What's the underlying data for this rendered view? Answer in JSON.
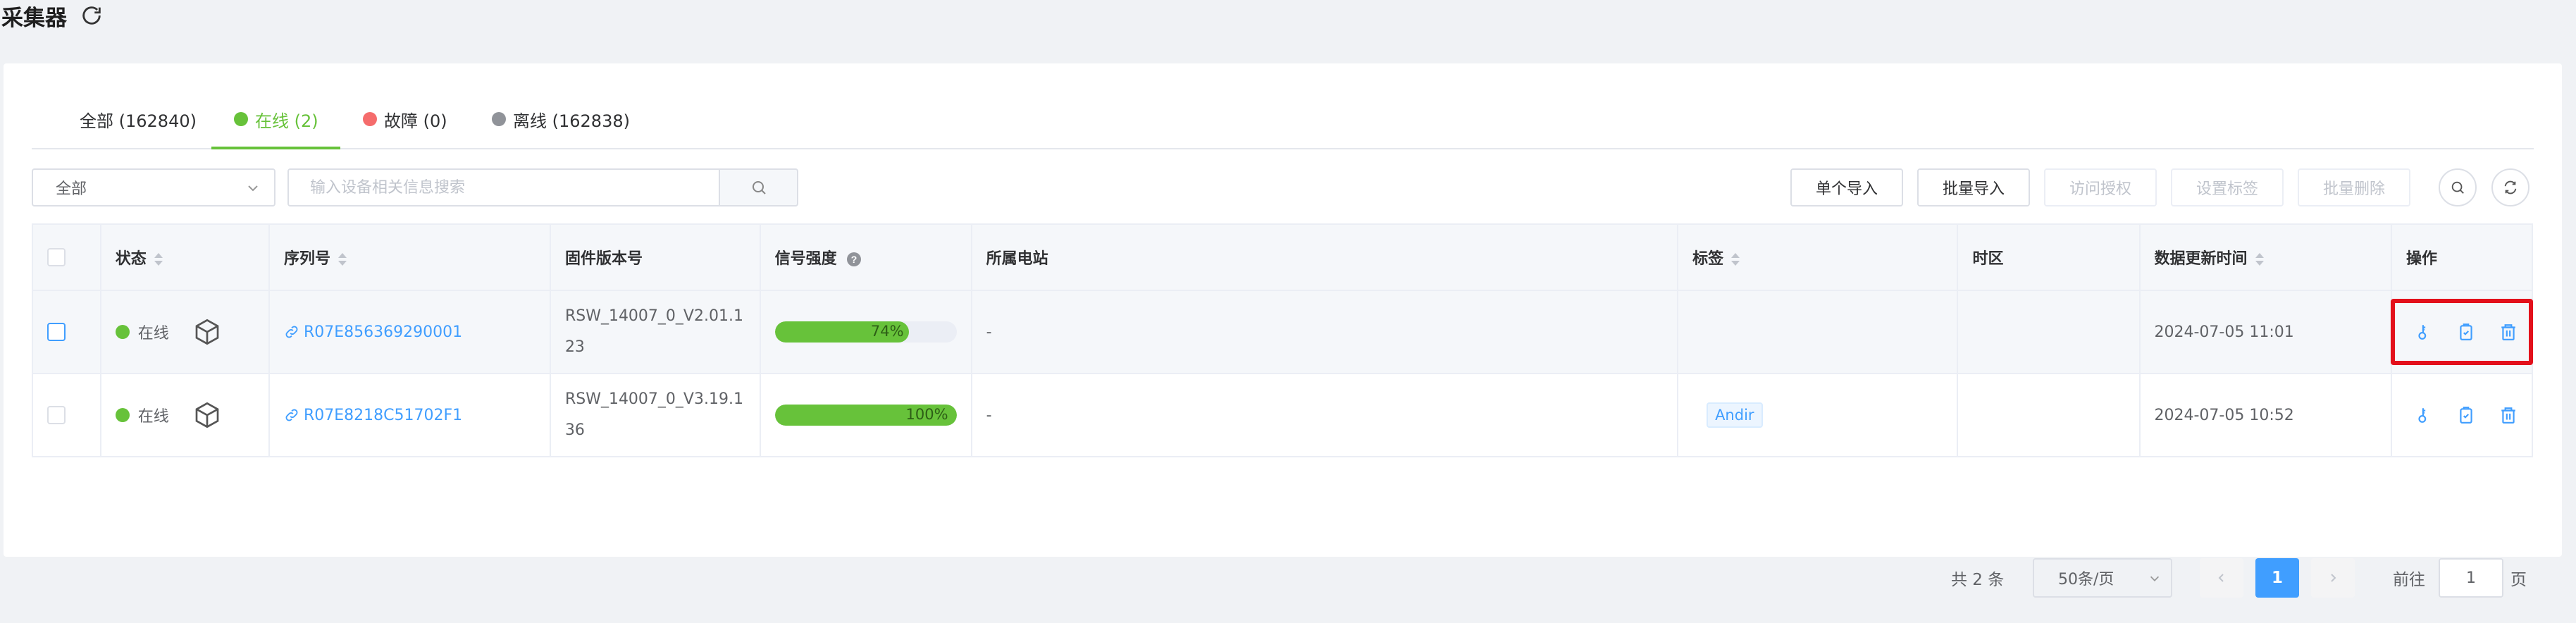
{
  "page": {
    "title": "采集器"
  },
  "tabs": [
    {
      "label": "全部 (162840)",
      "dot": ""
    },
    {
      "label": "在线 (2)",
      "dot": "#67c23a"
    },
    {
      "label": "故障 (0)",
      "dot": "#f56c6c"
    },
    {
      "label": "离线 (162838)",
      "dot": "#909399"
    }
  ],
  "active_tab": "在线 (2)",
  "toolbar": {
    "filter_value": "全部",
    "search_placeholder": "输入设备相关信息搜索",
    "single_import": "单个导入",
    "batch_import": "批量导入",
    "access_auth": "访问授权",
    "set_tags": "设置标签",
    "batch_delete": "批量删除"
  },
  "table": {
    "headers": {
      "status": "状态",
      "serial": "序列号",
      "firmware": "固件版本号",
      "signal": "信号强度",
      "station": "所属电站",
      "tags": "标签",
      "timezone": "时区",
      "updated": "数据更新时间",
      "actions": "操作"
    },
    "rows": [
      {
        "status": "在线",
        "serial": "R07E856369290001",
        "firmware": "RSW_14007_0_V2.01.123",
        "signal": "74%",
        "signal_value": 74,
        "station": "-",
        "tag": "",
        "timezone": "",
        "updated": "2024-07-05 11:01"
      },
      {
        "status": "在线",
        "serial": "R07E8218C51702F1",
        "firmware": "RSW_14007_0_V3.19.136",
        "signal": "100%",
        "signal_value": 100,
        "station": "-",
        "tag": "Andir",
        "timezone": "",
        "updated": "2024-07-05 10:52"
      }
    ]
  },
  "pagination": {
    "total_label": "共 2 条",
    "page_size": "50条/页",
    "current_page": "1",
    "goto_label": "前往",
    "goto_value": "1",
    "page_suffix": "页"
  },
  "icons": {
    "refresh": "refresh-icon",
    "search": "search-icon",
    "device": "cube-icon",
    "link": "link-icon",
    "key": "key-icon",
    "clipboard": "clipboard-icon",
    "delete": "trash-icon"
  },
  "colors": {
    "online": "#67c23a",
    "fault": "#f56c6c",
    "offline": "#909399",
    "primary": "#409eff",
    "highlight": "#e3101b"
  }
}
